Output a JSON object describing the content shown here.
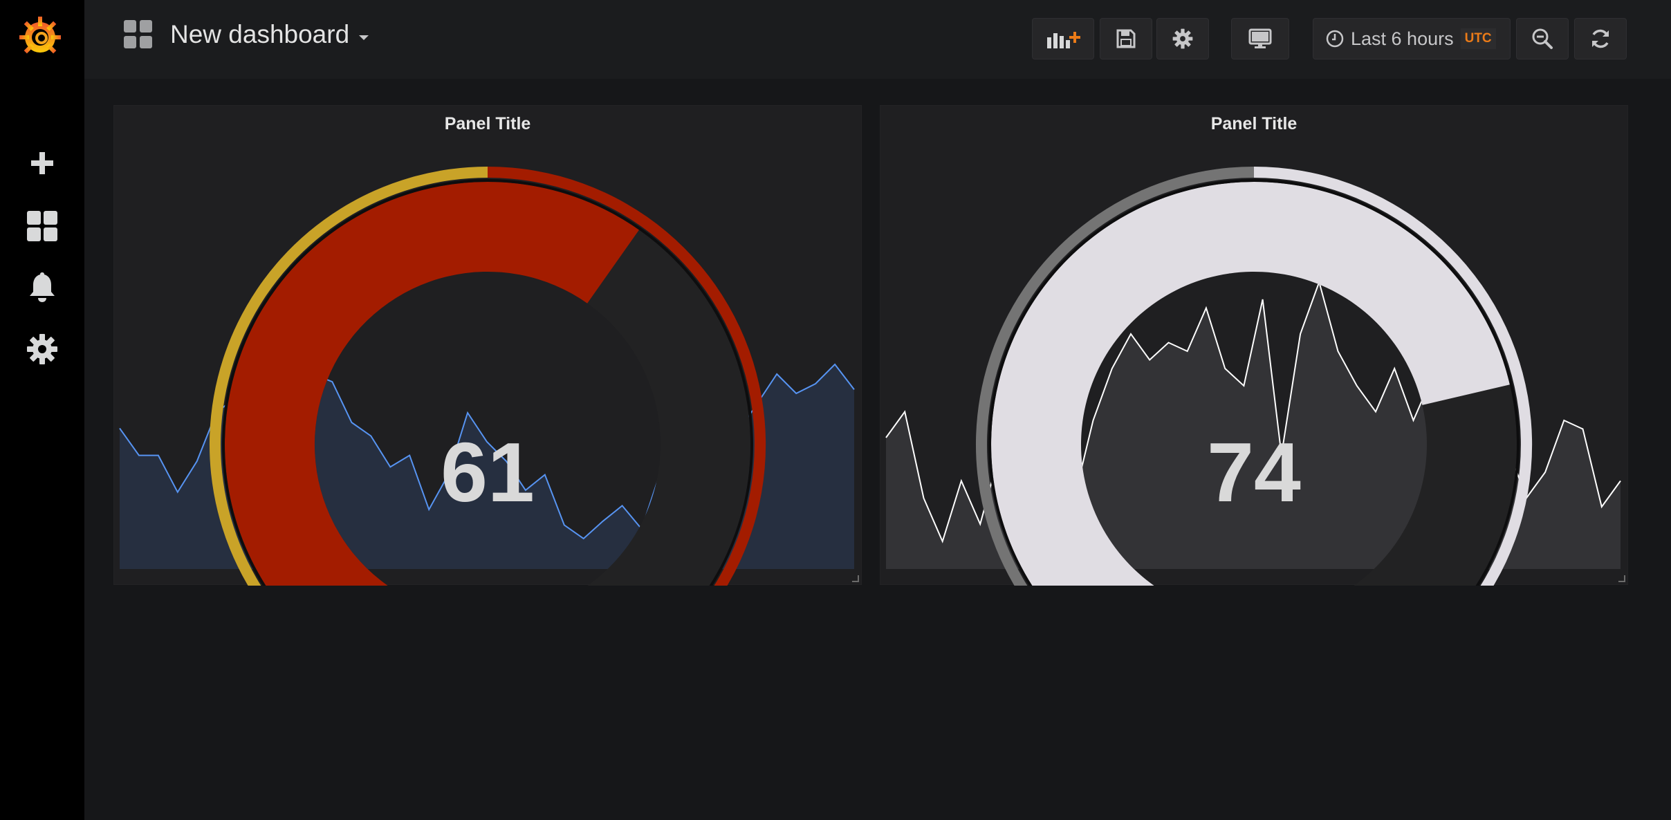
{
  "dashboard": {
    "title": "New dashboard"
  },
  "sidebar": {
    "items": [
      {
        "name": "create",
        "icon": "plus-icon"
      },
      {
        "name": "dashboards",
        "icon": "dashboards-grid-icon"
      },
      {
        "name": "alerting",
        "icon": "bell-icon"
      },
      {
        "name": "configuration",
        "icon": "gear-icon"
      }
    ]
  },
  "toolbar": {
    "add_panel_icon": "add-panel-icon",
    "save_icon": "save-icon",
    "settings_icon": "gear-icon",
    "tv_mode_icon": "monitor-icon",
    "time_range": "Last 6 hours",
    "timezone": "UTC",
    "zoom_out_icon": "zoom-out-icon",
    "refresh_icon": "refresh-icon"
  },
  "panels": [
    {
      "title": "Panel Title",
      "value": "61",
      "gauge": {
        "min": 0,
        "max": 100,
        "value": 61,
        "fill_color": "#a31c00",
        "threshold_colors": [
          "#7eb26d",
          "#c9a328",
          "#a31c00"
        ],
        "thresholds": [
          10,
          50
        ]
      },
      "sparkline": {
        "color": "#5794f2",
        "fill": "#262f40"
      }
    },
    {
      "title": "Panel Title",
      "value": "74",
      "gauge": {
        "min": 0,
        "max": 100,
        "value": 74,
        "fill_color": "#e0dde3",
        "threshold_colors": [
          "#262626",
          "#747474",
          "#e0dde3"
        ],
        "thresholds": [
          10,
          50
        ]
      },
      "sparkline": {
        "color": "#ffffff",
        "fill": "#333336"
      }
    }
  ]
}
